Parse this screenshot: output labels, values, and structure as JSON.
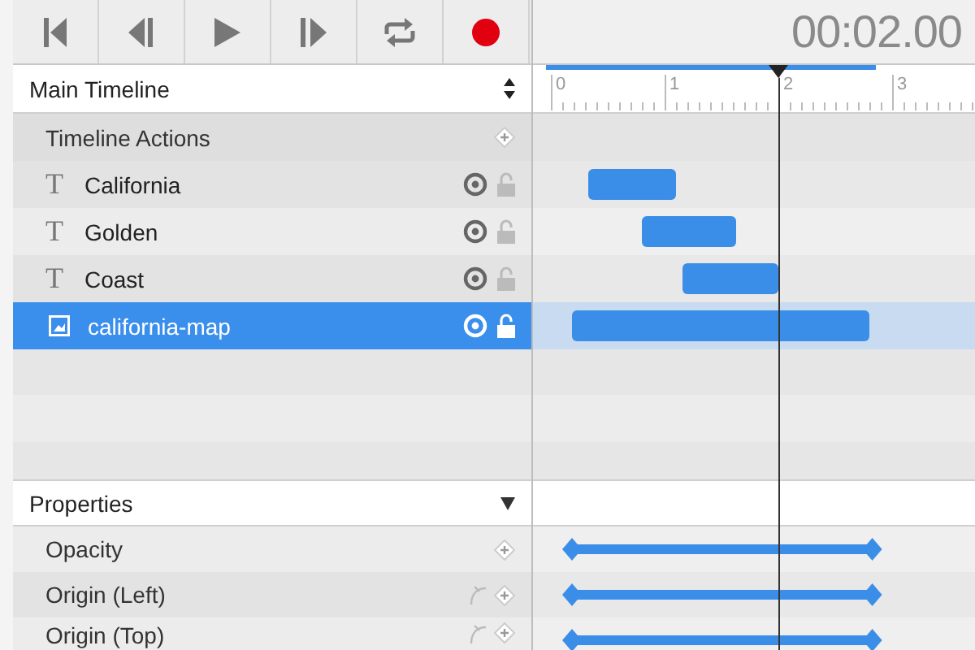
{
  "toolbar": {
    "buttons": [
      {
        "kind": "skip-start"
      },
      {
        "kind": "step-back"
      },
      {
        "kind": "play"
      },
      {
        "kind": "step-forward"
      },
      {
        "kind": "loop"
      },
      {
        "kind": "record"
      }
    ],
    "timecode": "00:02.00"
  },
  "timeline_selector": {
    "label": "Main Timeline"
  },
  "ruler": {
    "ticks": [
      "0",
      "1",
      "2",
      "3"
    ]
  },
  "timeline_actions": {
    "label": "Timeline Actions"
  },
  "layers": [
    {
      "kind": "text",
      "icon": "T",
      "name": "California",
      "selected": false
    },
    {
      "kind": "text",
      "icon": "T",
      "name": "Golden",
      "selected": false
    },
    {
      "kind": "text",
      "icon": "T",
      "name": "Coast",
      "selected": false
    },
    {
      "kind": "image",
      "name": "california-map",
      "selected": true
    }
  ],
  "properties": {
    "label": "Properties",
    "expanded": true,
    "rows": [
      {
        "name": "Opacity",
        "curve": false
      },
      {
        "name": "Origin (Left)",
        "curve": true
      },
      {
        "name": "Origin (Top)",
        "curve": true
      }
    ]
  }
}
